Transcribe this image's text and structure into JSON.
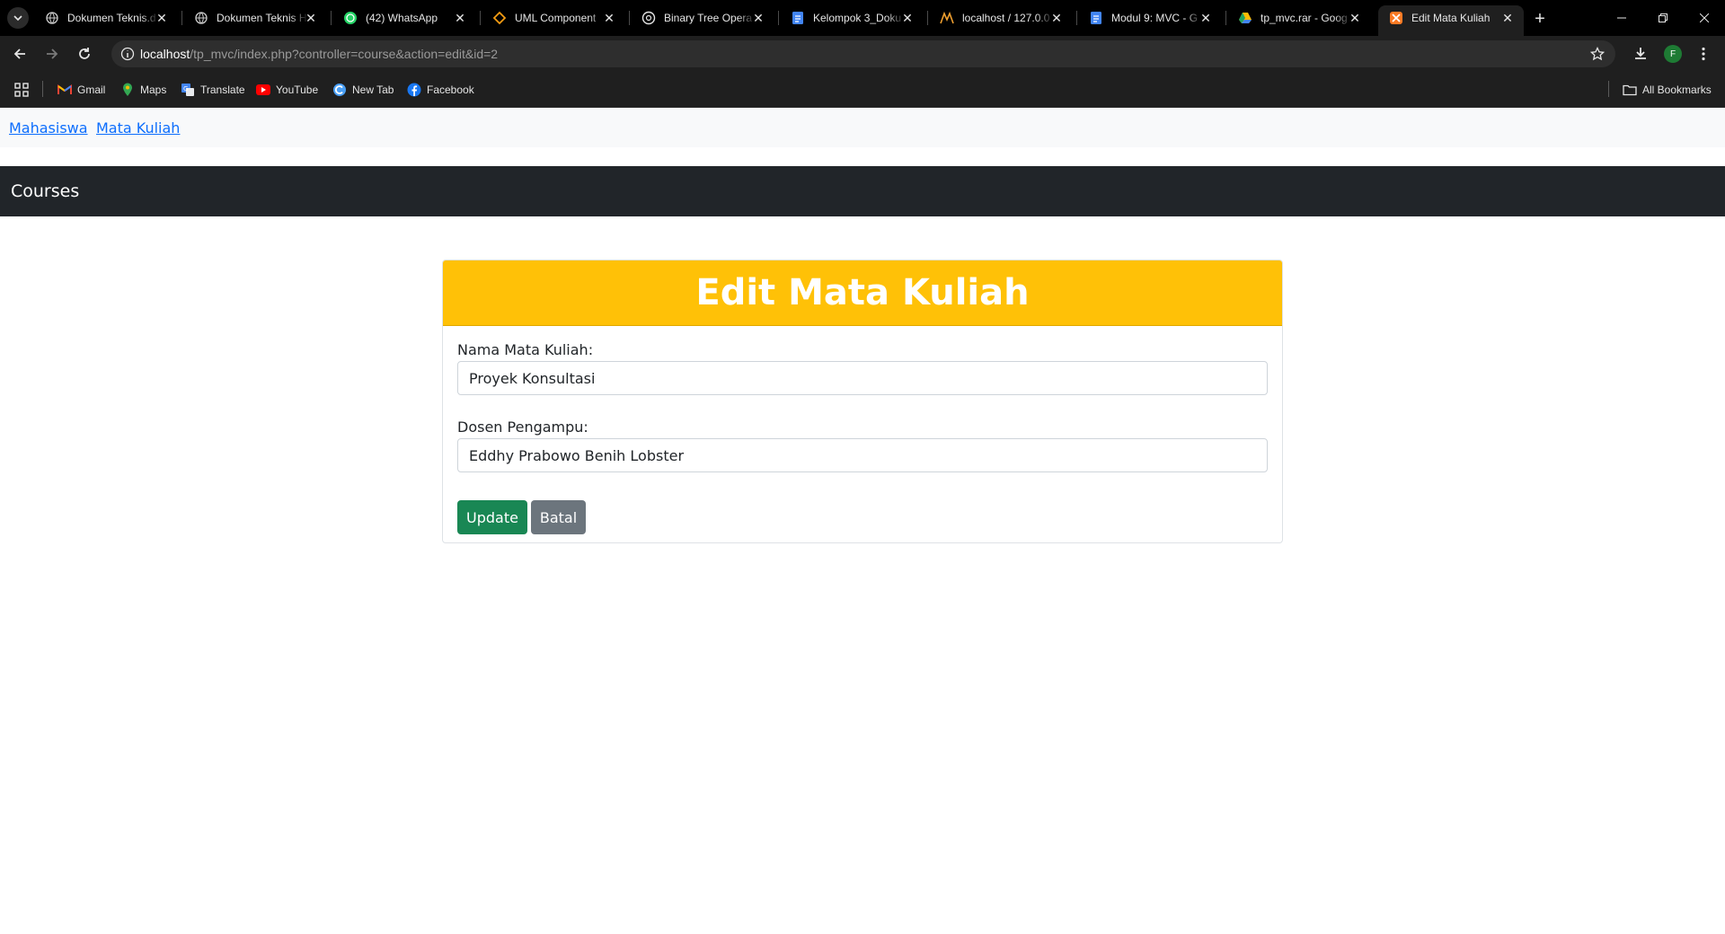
{
  "browser": {
    "tabs": [
      {
        "title": "Dokumen Teknis.d",
        "icon": "globe-icon"
      },
      {
        "title": "Dokumen Teknis H",
        "icon": "globe-icon"
      },
      {
        "title": "(42) WhatsApp",
        "icon": "whatsapp-icon"
      },
      {
        "title": "UML Component",
        "icon": "diamond-icon"
      },
      {
        "title": "Binary Tree Opera",
        "icon": "openai-icon"
      },
      {
        "title": "Kelompok 3_Doku",
        "icon": "docs-icon"
      },
      {
        "title": "localhost / 127.0.0",
        "icon": "phpmyadmin-icon"
      },
      {
        "title": "Modul 9: MVC - G",
        "icon": "docs-icon"
      },
      {
        "title": "tp_mvc.rar - Goog",
        "icon": "drive-icon"
      },
      {
        "title": "Edit Mata Kuliah",
        "icon": "xampp-icon",
        "active": true
      }
    ],
    "address": {
      "host": "localhost",
      "path": "/tp_mvc/index.php?controller=course&action=edit&id=2"
    },
    "profile_initial": "F",
    "bookmarks": [
      {
        "label": "Gmail",
        "icon": "gmail-icon"
      },
      {
        "label": "Maps",
        "icon": "maps-icon"
      },
      {
        "label": "Translate",
        "icon": "translate-icon"
      },
      {
        "label": "YouTube",
        "icon": "youtube-icon"
      },
      {
        "label": "New Tab",
        "icon": "newtab-icon"
      },
      {
        "label": "Facebook",
        "icon": "facebook-icon"
      }
    ],
    "all_bookmarks_label": "All Bookmarks"
  },
  "page": {
    "nav_links": [
      "Mahasiswa",
      "Mata Kuliah"
    ],
    "brand": "Courses",
    "card_title": "Edit Mata Kuliah",
    "fields": [
      {
        "label": "Nama Mata Kuliah:",
        "value": "Proyek Konsultasi"
      },
      {
        "label": "Dosen Pengampu:",
        "value": "Eddhy Prabowo Benih Lobster"
      }
    ],
    "buttons": {
      "update": "Update",
      "cancel": "Batal"
    }
  },
  "colors": {
    "card_header": "#ffc107",
    "update_button": "#198754",
    "cancel_button": "#6c757d",
    "navbar_dark": "#212529",
    "link": "#0d6efd"
  }
}
